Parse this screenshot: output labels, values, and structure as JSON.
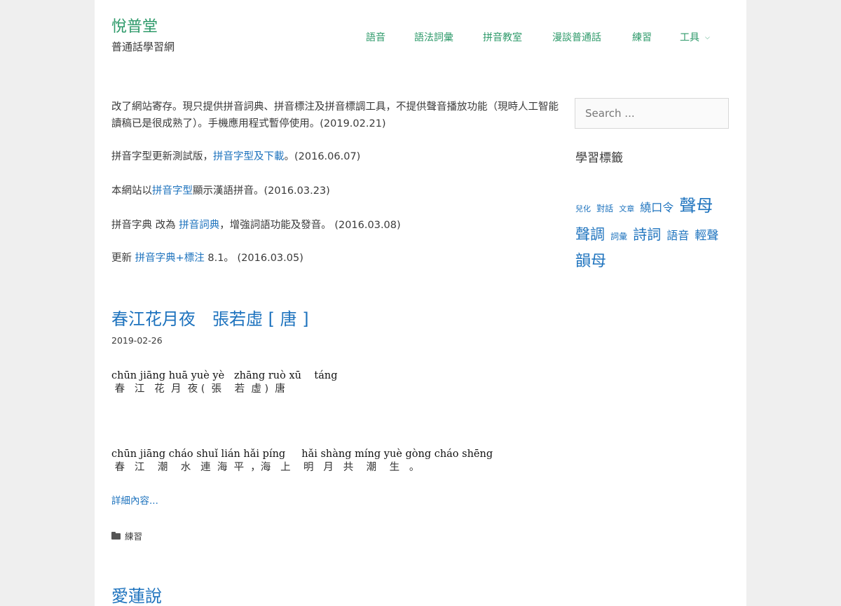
{
  "site": {
    "title": "悅普堂",
    "description": "普通話學習網"
  },
  "nav": {
    "items": [
      {
        "label": "語音"
      },
      {
        "label": "語法詞彙"
      },
      {
        "label": "拼音教室"
      },
      {
        "label": "漫談普通話"
      },
      {
        "label": "練習"
      },
      {
        "label": "工具",
        "chevron": "chevron-down-icon"
      }
    ]
  },
  "notices": [
    {
      "text": "改了網站寄存。現只提供拼音詞典、拼音標注及拼音標調工具，不提供聲音播放功能（現時人工智能讀稿已是很成熟了）。手機應用程式暫停使用。(2019.02.21)"
    },
    {
      "before": "拼音字型更新測試版，",
      "link": "拼音字型及下載",
      "after": "。(2016.06.07)"
    },
    {
      "before": "本網站以",
      "link": "拼音字型",
      "after": "顯示漢語拼音。(2016.03.23)"
    },
    {
      "before": "拼音字典 改為 ",
      "link": "拼音詞典",
      "after": "，增強詞語功能及發音。 (2016.03.08)"
    },
    {
      "before": "更新 ",
      "link": "拼音字典+標注",
      "after": " 8.1。 (2016.03.05)"
    }
  ],
  "post": {
    "title": "春江花月夜　張若虛 [ 唐 ]",
    "date": "2019-02-26",
    "pinyin_line1": "chūn jiāng huā yuè yè   zhāng ruò xū    táng",
    "hanzi_line1": " 春   江   花  月  夜 (  張    若  虛 )  唐",
    "pinyin_line2": "chūn jiāng cháo shuǐ lián hǎi píng     hǎi shàng míng yuè gòng cháo shēng",
    "hanzi_line2": " 春   江    潮    水   連  海  平  ，海   上    明   月   共    潮    生   。",
    "more": "詳細內容...",
    "category": "練習",
    "category_icon": "folder-icon"
  },
  "next_post": {
    "title": "愛蓮說"
  },
  "sidebar": {
    "search_placeholder": "Search ...",
    "widget_title": "學習標籤",
    "tags": [
      "兒化",
      "對話",
      "文章",
      "繞口令",
      "聲母",
      "聲調",
      "詞彙",
      "詩詞",
      "語音",
      "輕聲",
      "韻母"
    ]
  },
  "colors": {
    "brand": "#2e9a6a",
    "link": "#1e73be",
    "background": "#efefef"
  }
}
